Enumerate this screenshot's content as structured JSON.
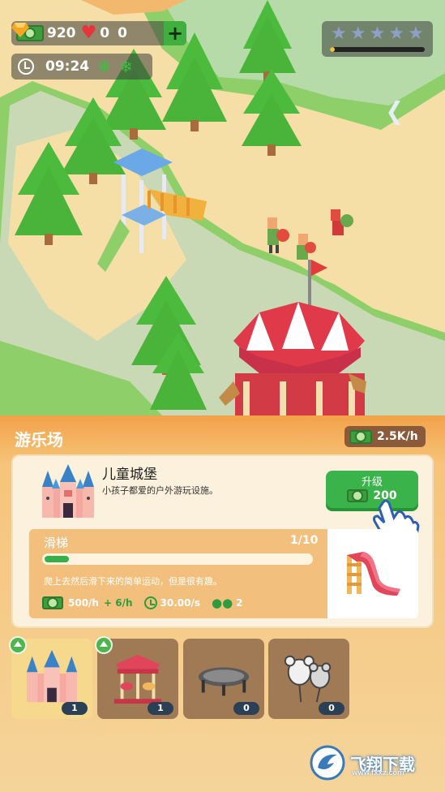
{
  "hud": {
    "cash": "920",
    "hearts": "0",
    "gems": "0",
    "plus_label": "+",
    "time": "09:24",
    "rating_stars": 5,
    "rating_filled": 0,
    "rating_progress": 0.05
  },
  "panel": {
    "title": "游乐场",
    "income_rate": "2.5K/h"
  },
  "attraction": {
    "name": "儿童城堡",
    "description": "小孩子都爱的户外游玩设施。",
    "upgrade_label": "升级",
    "upgrade_cost": "200"
  },
  "facility": {
    "name": "滑梯",
    "level": "1/10",
    "progress": 0.1,
    "description": "爬上去然后滑下来的简单运动，但是很有趣。",
    "income": "500/h",
    "income_bonus": "+ 6/h",
    "speed": "30.00/s",
    "capacity": "2"
  },
  "slots": [
    {
      "name": "castle",
      "count": "1",
      "upgradable": true,
      "active": true
    },
    {
      "name": "carousel",
      "count": "1",
      "upgradable": true,
      "active": false
    },
    {
      "name": "trampoline",
      "count": "0",
      "upgradable": false,
      "active": false
    },
    {
      "name": "balloons",
      "count": "0",
      "upgradable": false,
      "active": false
    }
  ],
  "watermark": {
    "text": "飞翔下载",
    "url": "www.fxxz.com"
  },
  "colors": {
    "panel_orange": "#f3a24a",
    "upgrade_green": "#3ab44a",
    "slot_brown": "#a07a55",
    "slot_active": "#f7d98e"
  }
}
